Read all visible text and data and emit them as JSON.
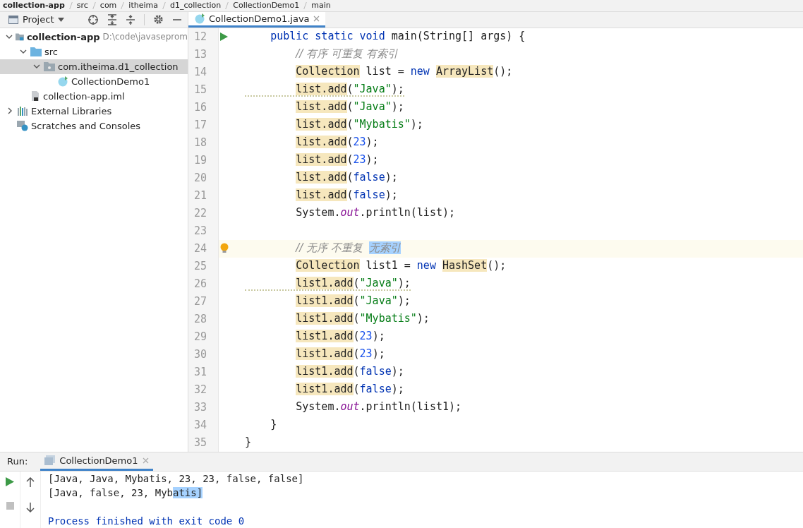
{
  "breadcrumb": [
    "collection-app",
    "src",
    "com",
    "itheima",
    "d1_collection",
    "CollectionDemo1",
    "main"
  ],
  "project_panel": {
    "title": "Project",
    "tree": [
      {
        "label": "collection-app",
        "path": "D:\\code\\javaseprom",
        "kind": "module",
        "expanded": true,
        "selected": false,
        "children": [
          {
            "label": "src",
            "kind": "folder",
            "expanded": true,
            "selected": false,
            "children": [
              {
                "label": "com.itheima.d1_collection",
                "kind": "package",
                "expanded": true,
                "selected": true,
                "children": [
                  {
                    "label": "CollectionDemo1",
                    "kind": "class",
                    "selected": false
                  }
                ]
              }
            ]
          },
          {
            "label": "collection-app.iml",
            "kind": "file",
            "selected": false
          }
        ]
      },
      {
        "label": "External Libraries",
        "kind": "libraries",
        "expanded": false,
        "selected": false
      },
      {
        "label": "Scratches and Consoles",
        "kind": "scratches",
        "selected": false
      }
    ]
  },
  "editor_tabs": [
    {
      "label": "CollectionDemo1.java",
      "selected": true
    }
  ],
  "code": [
    {
      "number": "12",
      "run": true,
      "current": false,
      "warning": false,
      "tokens": [
        {
          "text": "    public static void ",
          "kind": "keyword",
          "marked": false
        },
        {
          "text": "main(String[] args) {",
          "kind": "plain",
          "marked": false
        }
      ]
    },
    {
      "number": "13",
      "run": false,
      "current": false,
      "warning": false,
      "tokens": [
        {
          "text": "        // 有序 可重复 有索引",
          "kind": "comment",
          "marked": false
        }
      ]
    },
    {
      "number": "14",
      "run": false,
      "current": false,
      "warning": false,
      "tokens": [
        {
          "text": "        Collection",
          "kind": "plain",
          "marked": true
        },
        {
          "text": " list = ",
          "kind": "plain",
          "marked": false
        },
        {
          "text": "new ",
          "kind": "keyword",
          "marked": false
        },
        {
          "text": "ArrayList",
          "kind": "plain",
          "marked": true
        },
        {
          "text": "();",
          "kind": "plain",
          "marked": false
        }
      ]
    },
    {
      "number": "15",
      "run": false,
      "current": false,
      "warning": true,
      "tokens": [
        {
          "text": "        list.add",
          "kind": "plain",
          "marked": true
        },
        {
          "text": "(",
          "kind": "plain",
          "marked": false
        },
        {
          "text": "\"Java\"",
          "kind": "string",
          "marked": false
        },
        {
          "text": ");",
          "kind": "plain",
          "marked": false
        }
      ]
    },
    {
      "number": "16",
      "run": false,
      "current": false,
      "warning": false,
      "tokens": [
        {
          "text": "        list.add",
          "kind": "plain",
          "marked": true
        },
        {
          "text": "(",
          "kind": "plain",
          "marked": false
        },
        {
          "text": "\"Java\"",
          "kind": "string",
          "marked": false
        },
        {
          "text": ");",
          "kind": "plain",
          "marked": false
        }
      ]
    },
    {
      "number": "17",
      "run": false,
      "current": false,
      "warning": false,
      "tokens": [
        {
          "text": "        list.add",
          "kind": "plain",
          "marked": true
        },
        {
          "text": "(",
          "kind": "plain",
          "marked": false
        },
        {
          "text": "\"Mybatis\"",
          "kind": "string",
          "marked": false
        },
        {
          "text": ");",
          "kind": "plain",
          "marked": false
        }
      ]
    },
    {
      "number": "18",
      "run": false,
      "current": false,
      "warning": false,
      "tokens": [
        {
          "text": "        list.add",
          "kind": "plain",
          "marked": true
        },
        {
          "text": "(",
          "kind": "plain",
          "marked": false
        },
        {
          "text": "23",
          "kind": "number",
          "marked": false
        },
        {
          "text": ");",
          "kind": "plain",
          "marked": false
        }
      ]
    },
    {
      "number": "19",
      "run": false,
      "current": false,
      "warning": false,
      "tokens": [
        {
          "text": "        list.add",
          "kind": "plain",
          "marked": true
        },
        {
          "text": "(",
          "kind": "plain",
          "marked": false
        },
        {
          "text": "23",
          "kind": "number",
          "marked": false
        },
        {
          "text": ");",
          "kind": "plain",
          "marked": false
        }
      ]
    },
    {
      "number": "20",
      "run": false,
      "current": false,
      "warning": false,
      "tokens": [
        {
          "text": "        list.add",
          "kind": "plain",
          "marked": true
        },
        {
          "text": "(",
          "kind": "plain",
          "marked": false
        },
        {
          "text": "false",
          "kind": "keyword",
          "marked": false
        },
        {
          "text": ");",
          "kind": "plain",
          "marked": false
        }
      ]
    },
    {
      "number": "21",
      "run": false,
      "current": false,
      "warning": false,
      "tokens": [
        {
          "text": "        list.add",
          "kind": "plain",
          "marked": true
        },
        {
          "text": "(",
          "kind": "plain",
          "marked": false
        },
        {
          "text": "false",
          "kind": "keyword",
          "marked": false
        },
        {
          "text": ");",
          "kind": "plain",
          "marked": false
        }
      ]
    },
    {
      "number": "22",
      "run": false,
      "current": false,
      "warning": false,
      "tokens": [
        {
          "text": "        System.",
          "kind": "plain",
          "marked": false
        },
        {
          "text": "out",
          "kind": "field",
          "marked": false
        },
        {
          "text": ".println(list);",
          "kind": "plain",
          "marked": false
        }
      ]
    },
    {
      "number": "23",
      "run": false,
      "current": false
    },
    {
      "number": "24",
      "run": false,
      "current": true,
      "warning": false,
      "tokens": [
        {
          "text": "        // 无序 不重复  ",
          "kind": "comment",
          "marked": false
        },
        {
          "text": "无索引",
          "kind": "selection",
          "marked": false
        }
      ]
    },
    {
      "number": "25",
      "run": false,
      "current": false,
      "warning": false,
      "tokens": [
        {
          "text": "        Collection",
          "kind": "plain",
          "marked": true
        },
        {
          "text": " list1 = ",
          "kind": "plain",
          "marked": false
        },
        {
          "text": "new ",
          "kind": "keyword",
          "marked": false
        },
        {
          "text": "HashSet",
          "kind": "plain",
          "marked": true
        },
        {
          "text": "();",
          "kind": "plain",
          "marked": false
        }
      ]
    },
    {
      "number": "26",
      "run": false,
      "current": false,
      "warning": true,
      "tokens": [
        {
          "text": "        list1.add",
          "kind": "plain",
          "marked": true
        },
        {
          "text": "(",
          "kind": "plain",
          "marked": false
        },
        {
          "text": "\"Java\"",
          "kind": "string",
          "marked": false
        },
        {
          "text": ");",
          "kind": "plain",
          "marked": false
        }
      ]
    },
    {
      "number": "27",
      "run": false,
      "current": false,
      "warning": false,
      "tokens": [
        {
          "text": "        list1.add",
          "kind": "plain",
          "marked": true
        },
        {
          "text": "(",
          "kind": "plain",
          "marked": false
        },
        {
          "text": "\"Java\"",
          "kind": "string",
          "marked": false
        },
        {
          "text": ");",
          "kind": "plain",
          "marked": false
        }
      ]
    },
    {
      "number": "28",
      "run": false,
      "current": false,
      "warning": false,
      "tokens": [
        {
          "text": "        list1.add",
          "kind": "plain",
          "marked": true
        },
        {
          "text": "(",
          "kind": "plain",
          "marked": false
        },
        {
          "text": "\"Mybatis\"",
          "kind": "string",
          "marked": false
        },
        {
          "text": ");",
          "kind": "plain",
          "marked": false
        }
      ]
    },
    {
      "number": "29",
      "run": false,
      "current": false,
      "warning": false,
      "tokens": [
        {
          "text": "        list1.add",
          "kind": "plain",
          "marked": true
        },
        {
          "text": "(",
          "kind": "plain",
          "marked": false
        },
        {
          "text": "23",
          "kind": "number",
          "marked": false
        },
        {
          "text": ");",
          "kind": "plain",
          "marked": false
        }
      ]
    },
    {
      "number": "30",
      "run": false,
      "current": false,
      "warning": false,
      "tokens": [
        {
          "text": "        list1.add",
          "kind": "plain",
          "marked": true
        },
        {
          "text": "(",
          "kind": "plain",
          "marked": false
        },
        {
          "text": "23",
          "kind": "number",
          "marked": false
        },
        {
          "text": ");",
          "kind": "plain",
          "marked": false
        }
      ]
    },
    {
      "number": "31",
      "run": false,
      "current": false,
      "warning": false,
      "tokens": [
        {
          "text": "        list1.add",
          "kind": "plain",
          "marked": true
        },
        {
          "text": "(",
          "kind": "plain",
          "marked": false
        },
        {
          "text": "false",
          "kind": "keyword",
          "marked": false
        },
        {
          "text": ");",
          "kind": "plain",
          "marked": false
        }
      ]
    },
    {
      "number": "32",
      "run": false,
      "current": false,
      "warning": false,
      "tokens": [
        {
          "text": "        list1.add",
          "kind": "plain",
          "marked": true
        },
        {
          "text": "(",
          "kind": "plain",
          "marked": false
        },
        {
          "text": "false",
          "kind": "keyword",
          "marked": false
        },
        {
          "text": ");",
          "kind": "plain",
          "marked": false
        }
      ]
    },
    {
      "number": "33",
      "run": false,
      "current": false,
      "warning": false,
      "tokens": [
        {
          "text": "        System.",
          "kind": "plain",
          "marked": false
        },
        {
          "text": "out",
          "kind": "field",
          "marked": false
        },
        {
          "text": ".println(list1);",
          "kind": "plain",
          "marked": false
        }
      ]
    },
    {
      "number": "34",
      "run": false,
      "current": false,
      "warning": false,
      "tokens": [
        {
          "text": "    }",
          "kind": "plain",
          "marked": false
        }
      ]
    },
    {
      "number": "35",
      "run": false,
      "current": false,
      "warning": false,
      "tokens": [
        {
          "text": "}",
          "kind": "plain",
          "marked": false
        }
      ]
    }
  ],
  "run_panel": {
    "label": "Run:",
    "tabs": [
      {
        "label": "CollectionDemo1",
        "selected": true
      }
    ],
    "output": [
      {
        "segments": [
          {
            "text": "[Java, Java, Mybatis, 23, 23, false, false]",
            "selected": false
          }
        ],
        "kind": "stdout"
      },
      {
        "segments": [
          {
            "text": "[Java, false, 23, Myb",
            "selected": false
          },
          {
            "text": "atis]",
            "selected": true
          }
        ],
        "kind": "stdout"
      },
      {
        "kind": "stdout"
      },
      {
        "segments": [
          {
            "text": "Process finished with exit code 0",
            "selected": false
          }
        ],
        "kind": "system"
      }
    ]
  }
}
